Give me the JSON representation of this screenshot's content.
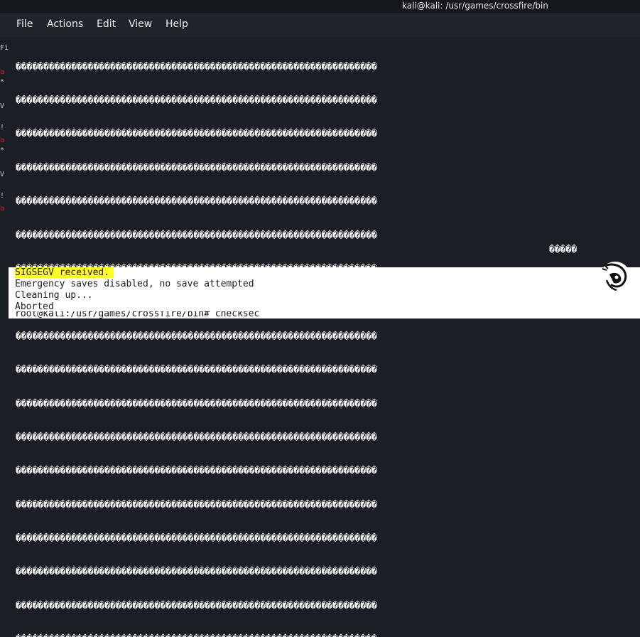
{
  "window": {
    "title": "kali@kali: /usr/games/crossfire/bin"
  },
  "menu": {
    "items": [
      "File",
      "Actions",
      "Edit",
      "View",
      "Help"
    ]
  },
  "left_strip": [
    "Fi",
    "a",
    "*",
    "V",
    "!",
    "a",
    "*",
    "V",
    "!",
    "a"
  ],
  "terminal": {
    "glyph_lines": [
      "�����������������������������������������������������������������",
      "�����������������������������������������������������������������",
      "�����������������������������������������������������������������",
      "�����������������������������������������������������������������",
      "�����������������������������������������������������������������",
      "�����������������������������������������������������������������",
      "�����������������������������������������������������������������",
      "�����������������������������������������������������������������",
      "�����������������������������������������������������������������",
      "�����������������������������������������������������������������",
      "�����������������������������������������������������������������",
      "�����������������������������������������������������������������",
      "�����������������������������������������������������������������",
      "�����������������������������������������������������������������",
      "�����������������������������������������������������������������",
      "�����������������������������������������������������������������",
      "�����������������������������������������������������������������",
      "�����������������������������������������������������������������"
    ],
    "glyph_tail": "�����",
    "signal_line": "SIGSEGV received.",
    "emergency_line": "Emergency saves disabled, no save attempted",
    "cleaning_line": "Cleaning up...",
    "aborted_line": "Aborted",
    "prompt_line": "root@kali:/usr/games/crossfire/bin# checksec"
  },
  "colors": {
    "highlight": "#ffff22",
    "terminal_bg": "#1b1e24",
    "menubar_bg": "#20242b",
    "titlebar_bg": "#14171c"
  },
  "icons": {
    "logo": "kali-dragon-logo"
  }
}
